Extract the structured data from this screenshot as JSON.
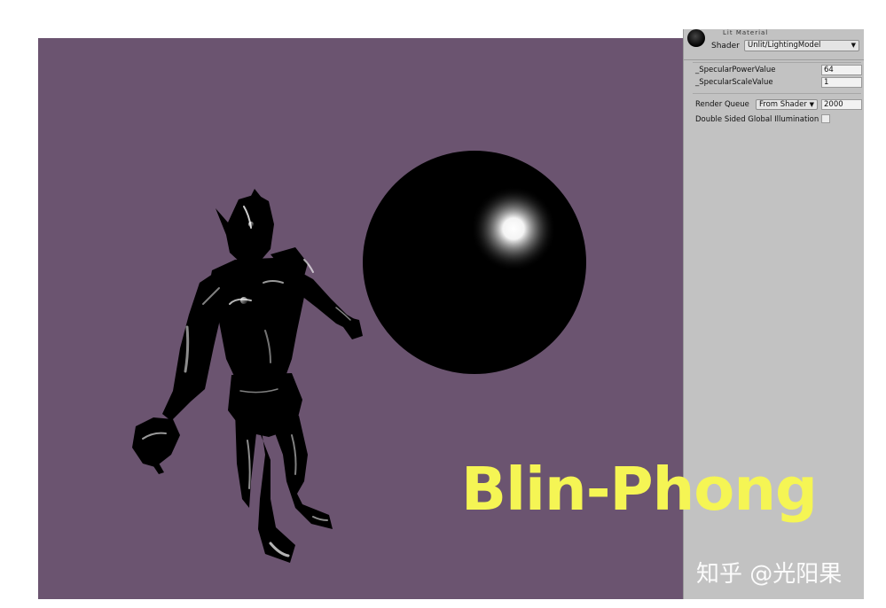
{
  "inspector": {
    "material_name": "Lit Material",
    "shader_label": "Shader",
    "shader_value": "Unlit/LightingModel",
    "properties": [
      {
        "label": "_SpecularPowerValue",
        "value": "64"
      },
      {
        "label": "_SpecularScaleValue",
        "value": "1"
      }
    ],
    "render_queue": {
      "label": "Render Queue",
      "option": "From Shader",
      "value": "2000"
    },
    "double_sided_gi": {
      "label": "Double Sided Global Illumination",
      "checked": false
    }
  },
  "overlay": {
    "title": "Blin-Phong",
    "watermark": "知乎 @光阳果"
  },
  "colors": {
    "viewport_bg": "#6b5470",
    "inspector_bg": "#c2c2c2",
    "title_color": "#f5f554"
  }
}
